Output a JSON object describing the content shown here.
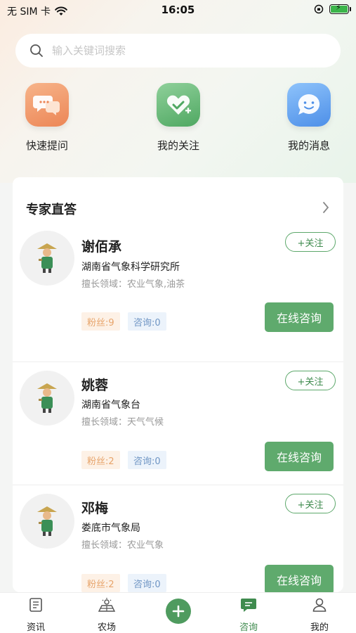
{
  "status": {
    "carrier": "无 SIM 卡",
    "time": "16:05"
  },
  "search": {
    "placeholder": "输入关键词搜索"
  },
  "quick_actions": [
    {
      "label": "快速提问",
      "icon": "chat-bubbles-icon"
    },
    {
      "label": "我的关注",
      "icon": "heart-plus-icon"
    },
    {
      "label": "我的消息",
      "icon": "message-smile-icon"
    }
  ],
  "experts_section": {
    "title": "专家直答",
    "experts": [
      {
        "name": "谢佰承",
        "org": "湖南省气象科学研究所",
        "field": "擅长领域：农业气象,油茶",
        "fans": "粉丝:9",
        "consults": "咨询:0",
        "follow_label": "+关注",
        "consult_label": "在线咨询"
      },
      {
        "name": "姚蓉",
        "org": "湖南省气象台",
        "field": "擅长领域：天气气候",
        "fans": "粉丝:2",
        "consults": "咨询:0",
        "follow_label": "+关注",
        "consult_label": "在线咨询"
      },
      {
        "name": "邓梅",
        "org": "娄底市气象局",
        "field": "擅长领域：农业气象",
        "fans": "粉丝:2",
        "consults": "咨询:0",
        "follow_label": "+关注",
        "consult_label": "在线咨询"
      }
    ]
  },
  "tabs": [
    {
      "label": "资讯",
      "icon": "document-icon",
      "active": false
    },
    {
      "label": "农场",
      "icon": "farm-icon",
      "active": false
    },
    {
      "label": "",
      "icon": "plus-icon",
      "active": false
    },
    {
      "label": "咨询",
      "icon": "consult-chat-icon",
      "active": true
    },
    {
      "label": "我的",
      "icon": "user-icon",
      "active": false
    }
  ],
  "colors": {
    "accent_green": "#5faa6d",
    "fans_badge_text": "#e7a46b",
    "consult_badge_text": "#6f95c4"
  }
}
